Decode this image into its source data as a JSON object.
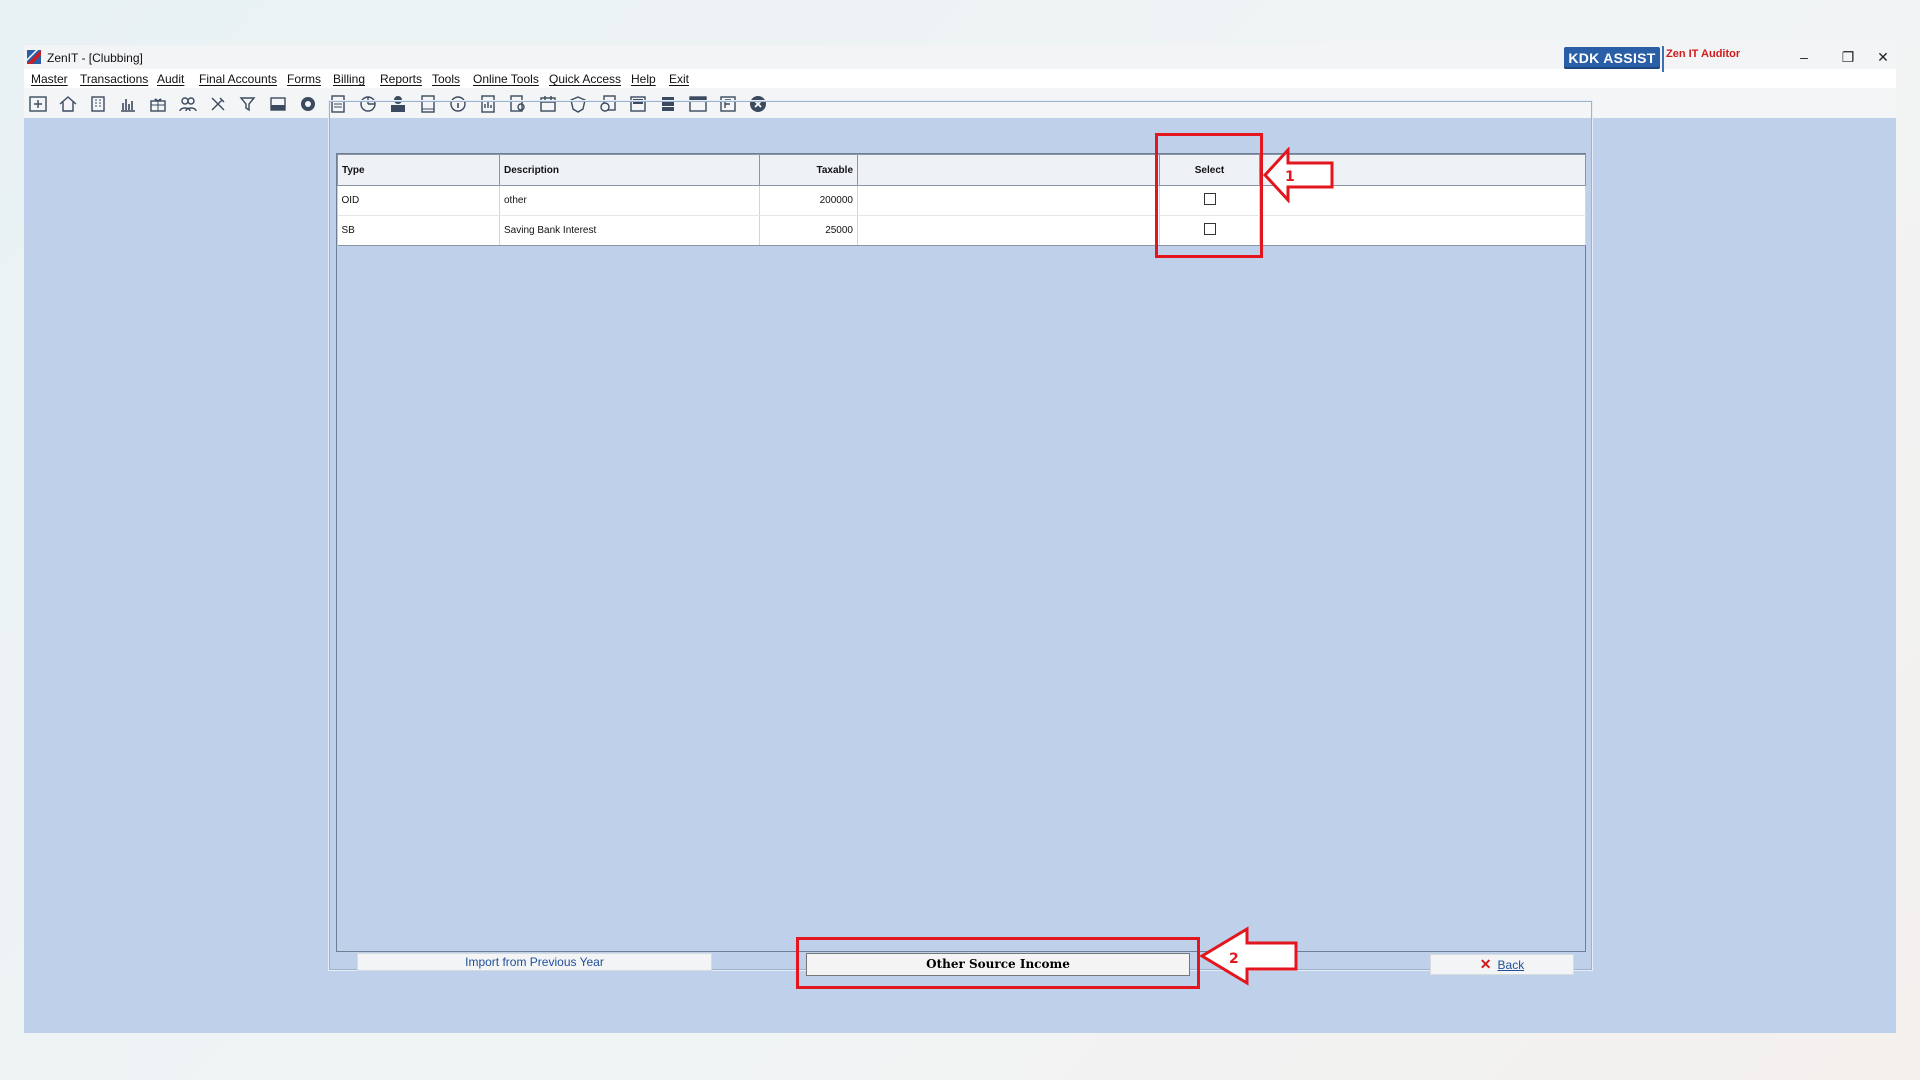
{
  "window": {
    "title": "ZenIT - [Clubbing]",
    "controls": {
      "minimize": "–",
      "restore": "❐",
      "close": "✕"
    }
  },
  "menu": [
    "Master",
    "Transactions",
    "Audit",
    "Final Accounts",
    "Forms",
    "Billing",
    "Reports",
    "Tools",
    "Online Tools",
    "Quick Access",
    "Help",
    "Exit"
  ],
  "toolbar": {
    "icons": [
      "import-icon",
      "home-icon",
      "building-icon",
      "bar-chart-icon",
      "gift-icon",
      "users-icon",
      "tools-icon",
      "filter-icon",
      "tax-icon",
      "coin-icon",
      "calculator-icon",
      "pie-chart-icon",
      "pay-icon",
      "book-icon",
      "info-icon",
      "report-icon",
      "doc-search-icon",
      "calendar-icon",
      "shield-icon",
      "refresh-doc-icon",
      "bs-icon",
      "stack-icon",
      "3cd-icon",
      "ledger-icon",
      "close-circle-icon"
    ],
    "kdk_assist": "KDK ASSIST",
    "zen_auditor": "Zen IT Auditor"
  },
  "table": {
    "columns": [
      "Type",
      "Description",
      "Taxable",
      "",
      "Select",
      ""
    ],
    "rows": [
      {
        "type": "OID",
        "description": "other",
        "taxable": "200000",
        "selected": false
      },
      {
        "type": "SB",
        "description": "Saving Bank Interest",
        "taxable": "25000",
        "selected": false
      }
    ]
  },
  "buttons": {
    "import": "Import from Previous Year",
    "other_source_income": "Other Source Income",
    "back": "Back"
  },
  "annotations": {
    "label1": "1",
    "label2": "2",
    "color": "#e3161d"
  },
  "colors": {
    "workspace": "#bed0ea",
    "kdk_blue": "#2a5ea6",
    "brand_red": "#d11b1b"
  }
}
